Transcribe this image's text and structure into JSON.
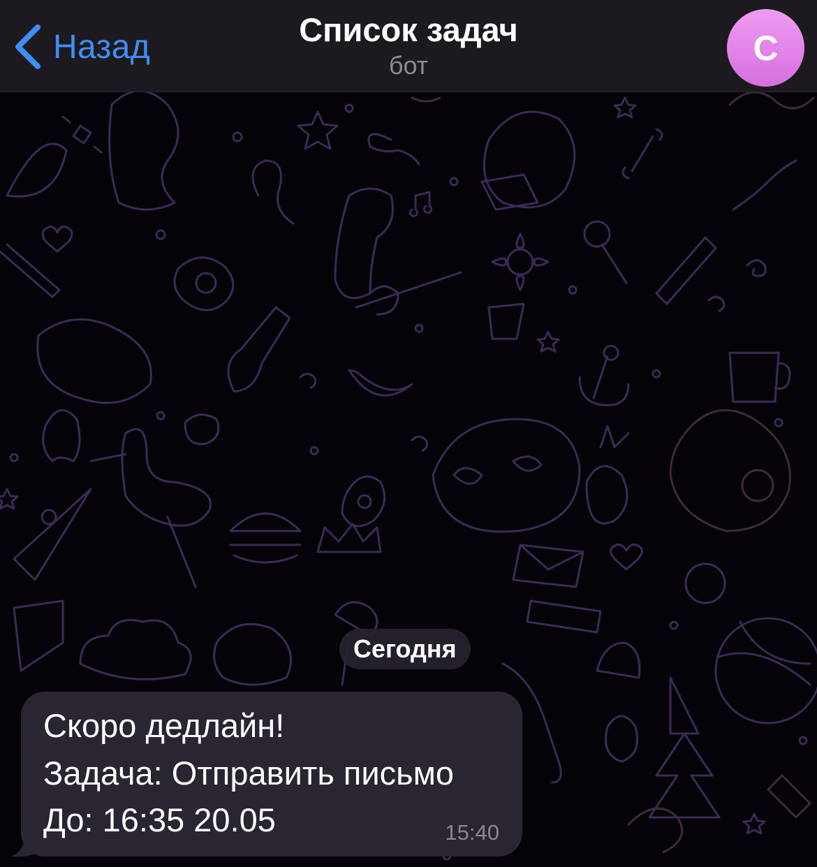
{
  "header": {
    "back_label": "Назад",
    "title": "Список задач",
    "subtitle": "бот",
    "avatar_letter": "C",
    "avatar_color": "#e287ea",
    "accent_color": "#3e8ef7",
    "back_icon": "chevron-left-icon"
  },
  "chat": {
    "date_separator": "Сегодня",
    "messages": [
      {
        "lines": [
          "Скоро дедлайн!",
          "Задача: Отправить письмо",
          "До: 16:35 20.05"
        ],
        "time": "15:40"
      }
    ]
  }
}
